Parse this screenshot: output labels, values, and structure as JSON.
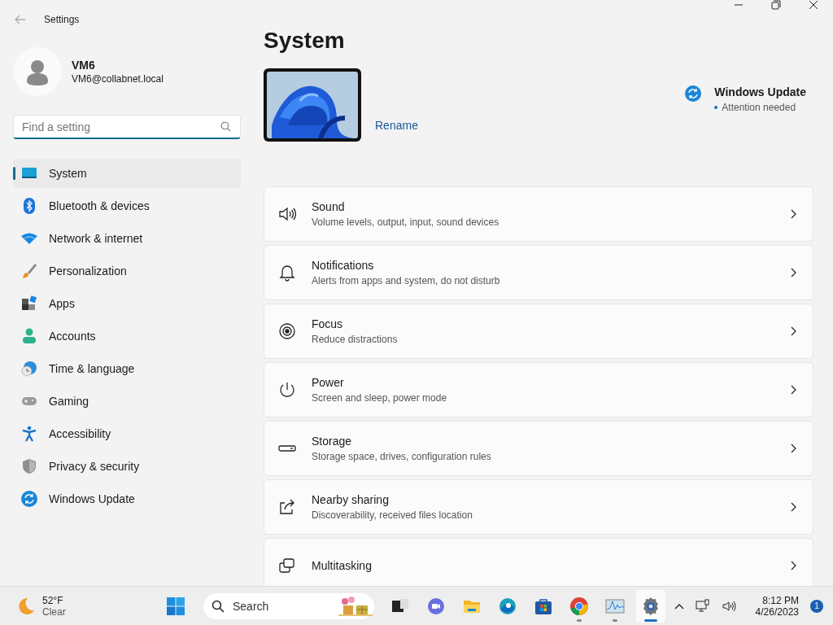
{
  "window": {
    "title": "Settings"
  },
  "account": {
    "name": "VM6",
    "email": "VM6@collabnet.local"
  },
  "search": {
    "placeholder": "Find a setting"
  },
  "sidebar": {
    "items": [
      {
        "label": "System",
        "kind": "system",
        "selected": true
      },
      {
        "label": "Bluetooth & devices",
        "kind": "bluetooth",
        "selected": false
      },
      {
        "label": "Network & internet",
        "kind": "network",
        "selected": false
      },
      {
        "label": "Personalization",
        "kind": "brush",
        "selected": false
      },
      {
        "label": "Apps",
        "kind": "apps",
        "selected": false
      },
      {
        "label": "Accounts",
        "kind": "accounts",
        "selected": false
      },
      {
        "label": "Time & language",
        "kind": "time",
        "selected": false
      },
      {
        "label": "Gaming",
        "kind": "gaming",
        "selected": false
      },
      {
        "label": "Accessibility",
        "kind": "accessibility",
        "selected": false
      },
      {
        "label": "Privacy & security",
        "kind": "privacy",
        "selected": false
      },
      {
        "label": "Windows Update",
        "kind": "update",
        "selected": false
      }
    ]
  },
  "page": {
    "title": "System",
    "device": {
      "kind": "picture",
      "action": "Rename"
    },
    "update": {
      "title": "Windows Update",
      "status": "Attention needed"
    },
    "cards": [
      {
        "title": "Sound",
        "subtitle": "Volume levels, output, input, sound devices",
        "kind": "sound"
      },
      {
        "title": "Notifications",
        "subtitle": "Alerts from apps and system, do not disturb",
        "kind": "bell"
      },
      {
        "title": "Focus",
        "subtitle": "Reduce distractions",
        "kind": "focus"
      },
      {
        "title": "Power",
        "subtitle": "Screen and sleep, power mode",
        "kind": "power"
      },
      {
        "title": "Storage",
        "subtitle": "Storage space, drives, configuration rules",
        "kind": "storage"
      },
      {
        "title": "Nearby sharing",
        "subtitle": "Discoverability, received files location",
        "kind": "share"
      },
      {
        "title": "Multitasking",
        "kind": "multitask"
      }
    ]
  },
  "taskbar": {
    "weather": {
      "temp": "52°F",
      "condition": "Clear"
    },
    "search": {
      "placeholder": "Search"
    },
    "apps": [
      {
        "kind": "taskview",
        "running": false,
        "selected": false
      },
      {
        "kind": "chat",
        "running": false,
        "selected": false
      },
      {
        "kind": "folder",
        "running": false,
        "selected": false
      },
      {
        "kind": "edge",
        "running": false,
        "selected": false
      },
      {
        "kind": "store",
        "running": false,
        "selected": false
      },
      {
        "kind": "chrome",
        "running": true,
        "selected": false
      },
      {
        "kind": "monitor",
        "running": true,
        "selected": false
      },
      {
        "kind": "settings",
        "running": true,
        "selected": true
      }
    ],
    "time": "8:12 PM",
    "date": "4/26/2023",
    "notifications": "1"
  }
}
